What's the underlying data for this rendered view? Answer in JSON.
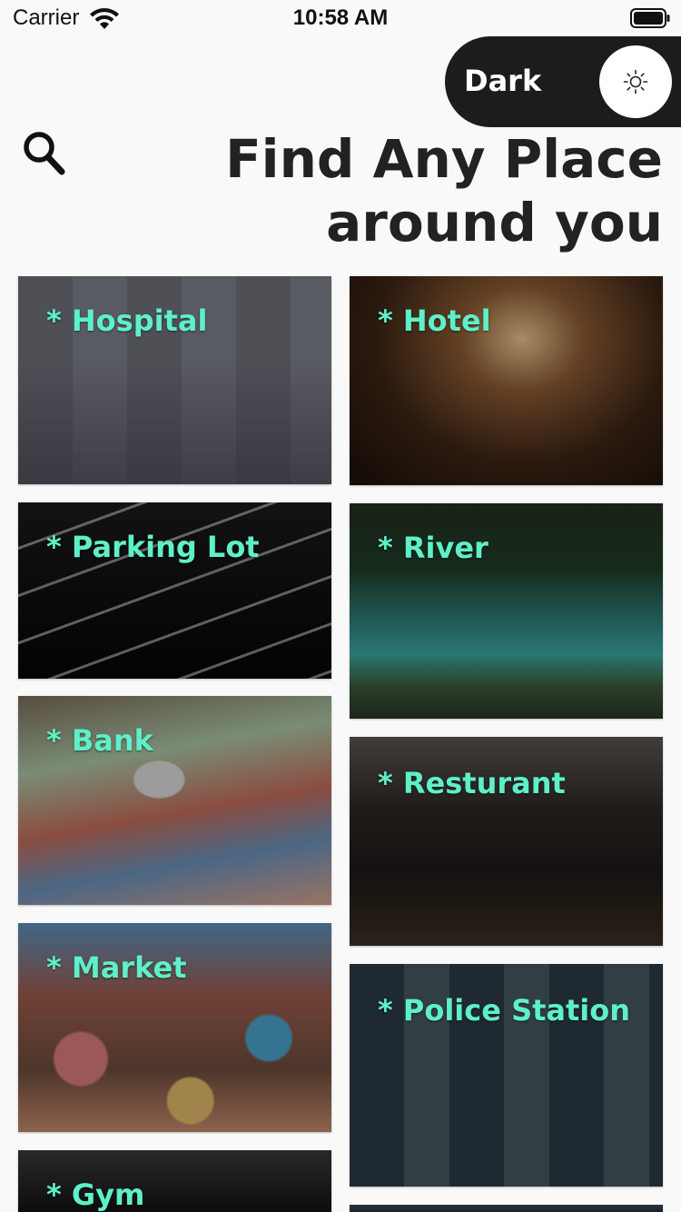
{
  "status_bar": {
    "carrier": "Carrier",
    "time": "10:58 AM"
  },
  "theme_toggle": {
    "label": "Dark",
    "icon": "sun-icon"
  },
  "header": {
    "search_icon": "search-icon",
    "title_line1": "Find Any Place",
    "title_line2": "around you"
  },
  "colors": {
    "accent_label": "#5ef0c8",
    "toggle_bg": "#1c1c1c",
    "page_bg": "#f9f9f9"
  },
  "places": {
    "left": [
      {
        "label": "* Hospital"
      },
      {
        "label": "* Parking Lot"
      },
      {
        "label": "* Bank"
      },
      {
        "label": "* Market"
      },
      {
        "label": "* Gym"
      }
    ],
    "right": [
      {
        "label": "* Hotel"
      },
      {
        "label": "* River"
      },
      {
        "label": "* Resturant"
      },
      {
        "label": "* Police Station"
      },
      {
        "label": ""
      }
    ]
  }
}
